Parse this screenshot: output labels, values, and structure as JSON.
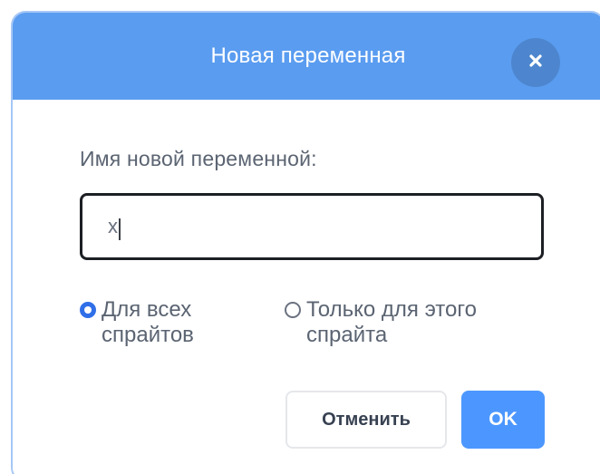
{
  "dialog": {
    "title": "Новая переменная",
    "close_icon": "close-icon",
    "field_label": "Имя новой переменной:",
    "input_value": "x",
    "radio_options": [
      {
        "label": "Для всех спрайтов",
        "selected": true
      },
      {
        "label": "Только для этого спрайта",
        "selected": false
      }
    ],
    "buttons": {
      "cancel": "Отменить",
      "ok": "OK"
    }
  },
  "colors": {
    "header_blue": "#5a9cf0",
    "primary_blue": "#4c97ff",
    "text_gray": "#5b6472"
  }
}
